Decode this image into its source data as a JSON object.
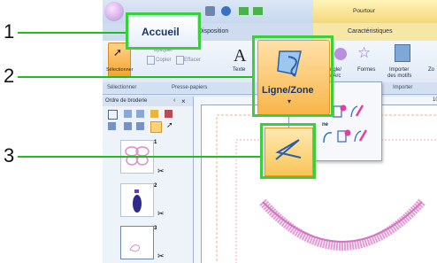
{
  "callouts": [
    "1",
    "2",
    "3"
  ],
  "app": {
    "tabs": {
      "accueil": "Accueil",
      "disposition": "Disposition",
      "caracteristiques": "Caractéristiques"
    },
    "contextual_tab": "Pourtour",
    "ribbon": {
      "select_label": "Sélectionner",
      "copy_label": "Copier",
      "delete_label": "Effacer",
      "duplicate_label": "upliquer",
      "text_label": "Texte",
      "shapes_label": "Formes",
      "rect_label": "tangle/",
      "arc_label": "de/Arc",
      "import_label": "Importer",
      "import_label2": "des motifs",
      "zoom_label": "Zo",
      "groups": {
        "select": "Sélectionner",
        "clipboard": "Presse-papiers",
        "import": "Importer"
      }
    },
    "dropdown": {
      "button_label": "Ligne/Zone",
      "partial_label": "ne",
      "icons": [
        "line-draw-icon",
        "curve-icon",
        "star-shape-icon",
        "paint-brush-icon"
      ]
    },
    "panel": {
      "title": "Ordre de broderie",
      "close_glyph": "×",
      "pin_glyph": "‹",
      "items": [
        {
          "index": "1",
          "name": "butterfly-pattern"
        },
        {
          "index": "2",
          "name": "bottle-pattern"
        },
        {
          "index": "3",
          "name": "outline-pattern"
        }
      ],
      "scissor_glyph": "✂"
    },
    "ruler_marks": [
      "10"
    ]
  }
}
